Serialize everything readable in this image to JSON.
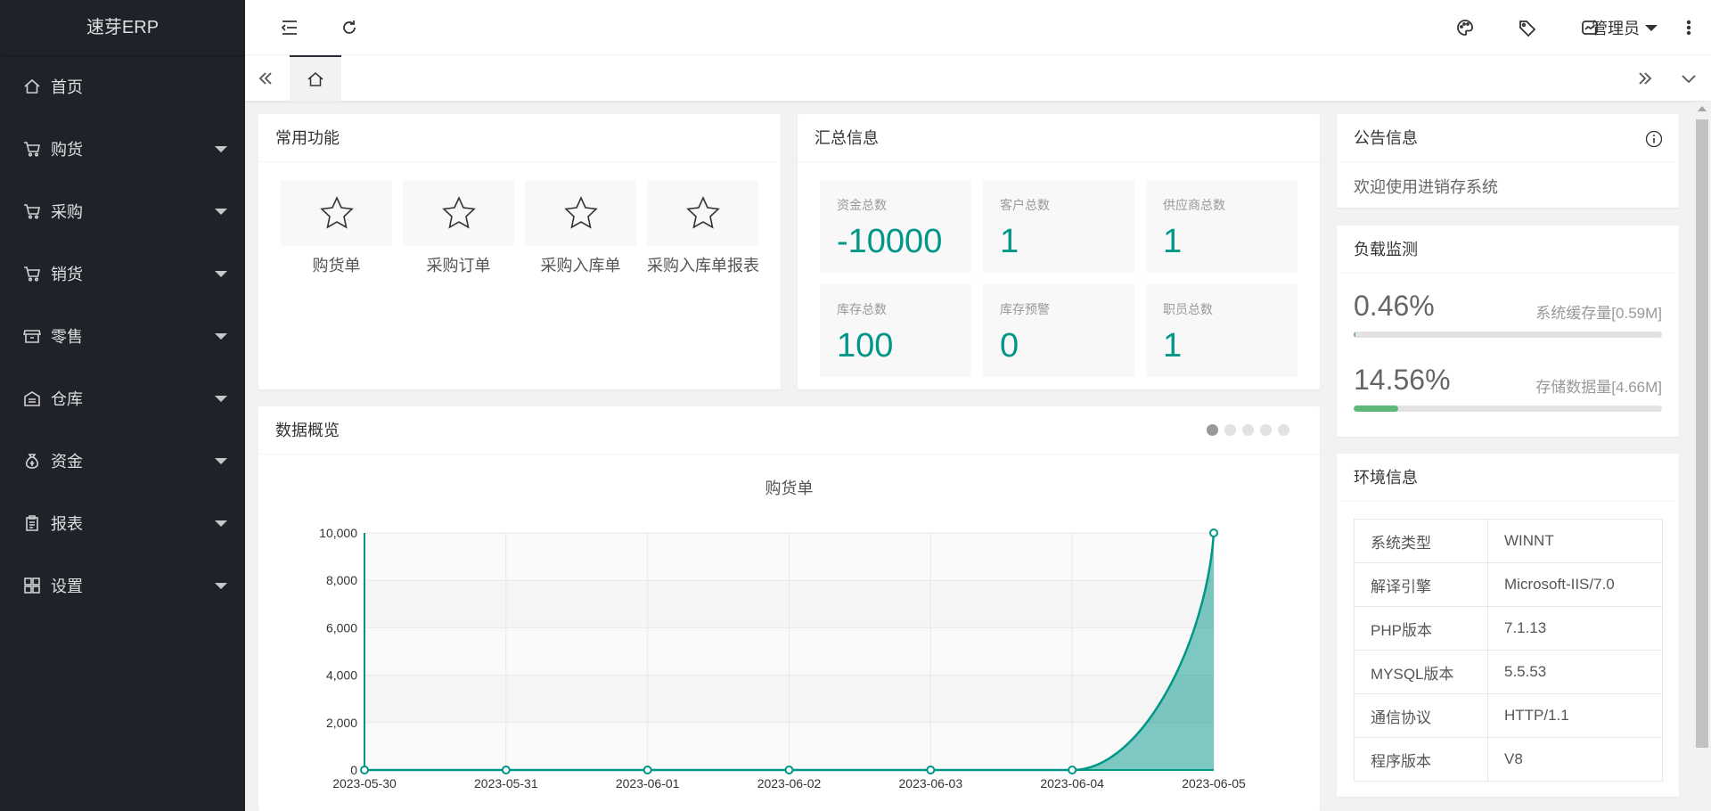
{
  "app": {
    "title": "速芽ERP"
  },
  "sidebar": {
    "items": [
      {
        "label": "首页",
        "icon": "home-icon",
        "has_children": false
      },
      {
        "label": "购货",
        "icon": "cart-icon",
        "has_children": true
      },
      {
        "label": "采购",
        "icon": "cart-icon",
        "has_children": true
      },
      {
        "label": "销货",
        "icon": "cart-icon",
        "has_children": true
      },
      {
        "label": "零售",
        "icon": "shop-icon",
        "has_children": true
      },
      {
        "label": "仓库",
        "icon": "warehouse-icon",
        "has_children": true
      },
      {
        "label": "资金",
        "icon": "money-bag-icon",
        "has_children": true
      },
      {
        "label": "报表",
        "icon": "clipboard-icon",
        "has_children": true
      },
      {
        "label": "设置",
        "icon": "grid-icon",
        "has_children": true
      }
    ]
  },
  "header": {
    "user_label": "管理员"
  },
  "common_functions": {
    "title": "常用功能",
    "items": [
      {
        "label": "购货单"
      },
      {
        "label": "采购订单"
      },
      {
        "label": "采购入库单"
      },
      {
        "label": "采购入库单报表"
      }
    ]
  },
  "summary": {
    "title": "汇总信息",
    "stats": [
      {
        "label": "资金总数",
        "value": "-10000"
      },
      {
        "label": "客户总数",
        "value": "1"
      },
      {
        "label": "供应商总数",
        "value": "1"
      },
      {
        "label": "库存总数",
        "value": "100"
      },
      {
        "label": "库存预警",
        "value": "0"
      },
      {
        "label": "职员总数",
        "value": "1"
      }
    ]
  },
  "notice": {
    "title": "公告信息",
    "text": "欢迎使用进销存系统"
  },
  "load": {
    "title": "负载监测",
    "rows": [
      {
        "percent": "0.46%",
        "caption": "系统缓存量[0.59M]",
        "value": 0.46
      },
      {
        "percent": "14.56%",
        "caption": "存储数据量[4.66M]",
        "value": 14.56
      }
    ]
  },
  "env": {
    "title": "环境信息",
    "rows": [
      {
        "key": "系统类型",
        "value": "WINNT"
      },
      {
        "key": "解译引擎",
        "value": "Microsoft-IIS/7.0"
      },
      {
        "key": "PHP版本",
        "value": "7.1.13"
      },
      {
        "key": "MYSQL版本",
        "value": "5.5.53"
      },
      {
        "key": "通信协议",
        "value": "HTTP/1.1"
      },
      {
        "key": "程序版本",
        "value": "V8"
      }
    ]
  },
  "overview": {
    "title": "数据概览",
    "carousel_pages": 5,
    "active_page": 0
  },
  "chart_data": {
    "type": "area",
    "title": "购货单",
    "categories": [
      "2023-05-30",
      "2023-05-31",
      "2023-06-01",
      "2023-06-02",
      "2023-06-03",
      "2023-06-04",
      "2023-06-05"
    ],
    "values": [
      0,
      0,
      0,
      0,
      0,
      0,
      10000
    ],
    "ylim": [
      0,
      10000
    ],
    "yticks": [
      0,
      2000,
      4000,
      6000,
      8000,
      10000
    ],
    "ytick_labels": [
      "0",
      "2,000",
      "4,000",
      "6,000",
      "8,000",
      "10,000"
    ],
    "grid": true,
    "color": "#009688"
  },
  "colors": {
    "accent": "#009688",
    "sidebar_bg": "#20222a",
    "progress": "#5fb878"
  }
}
